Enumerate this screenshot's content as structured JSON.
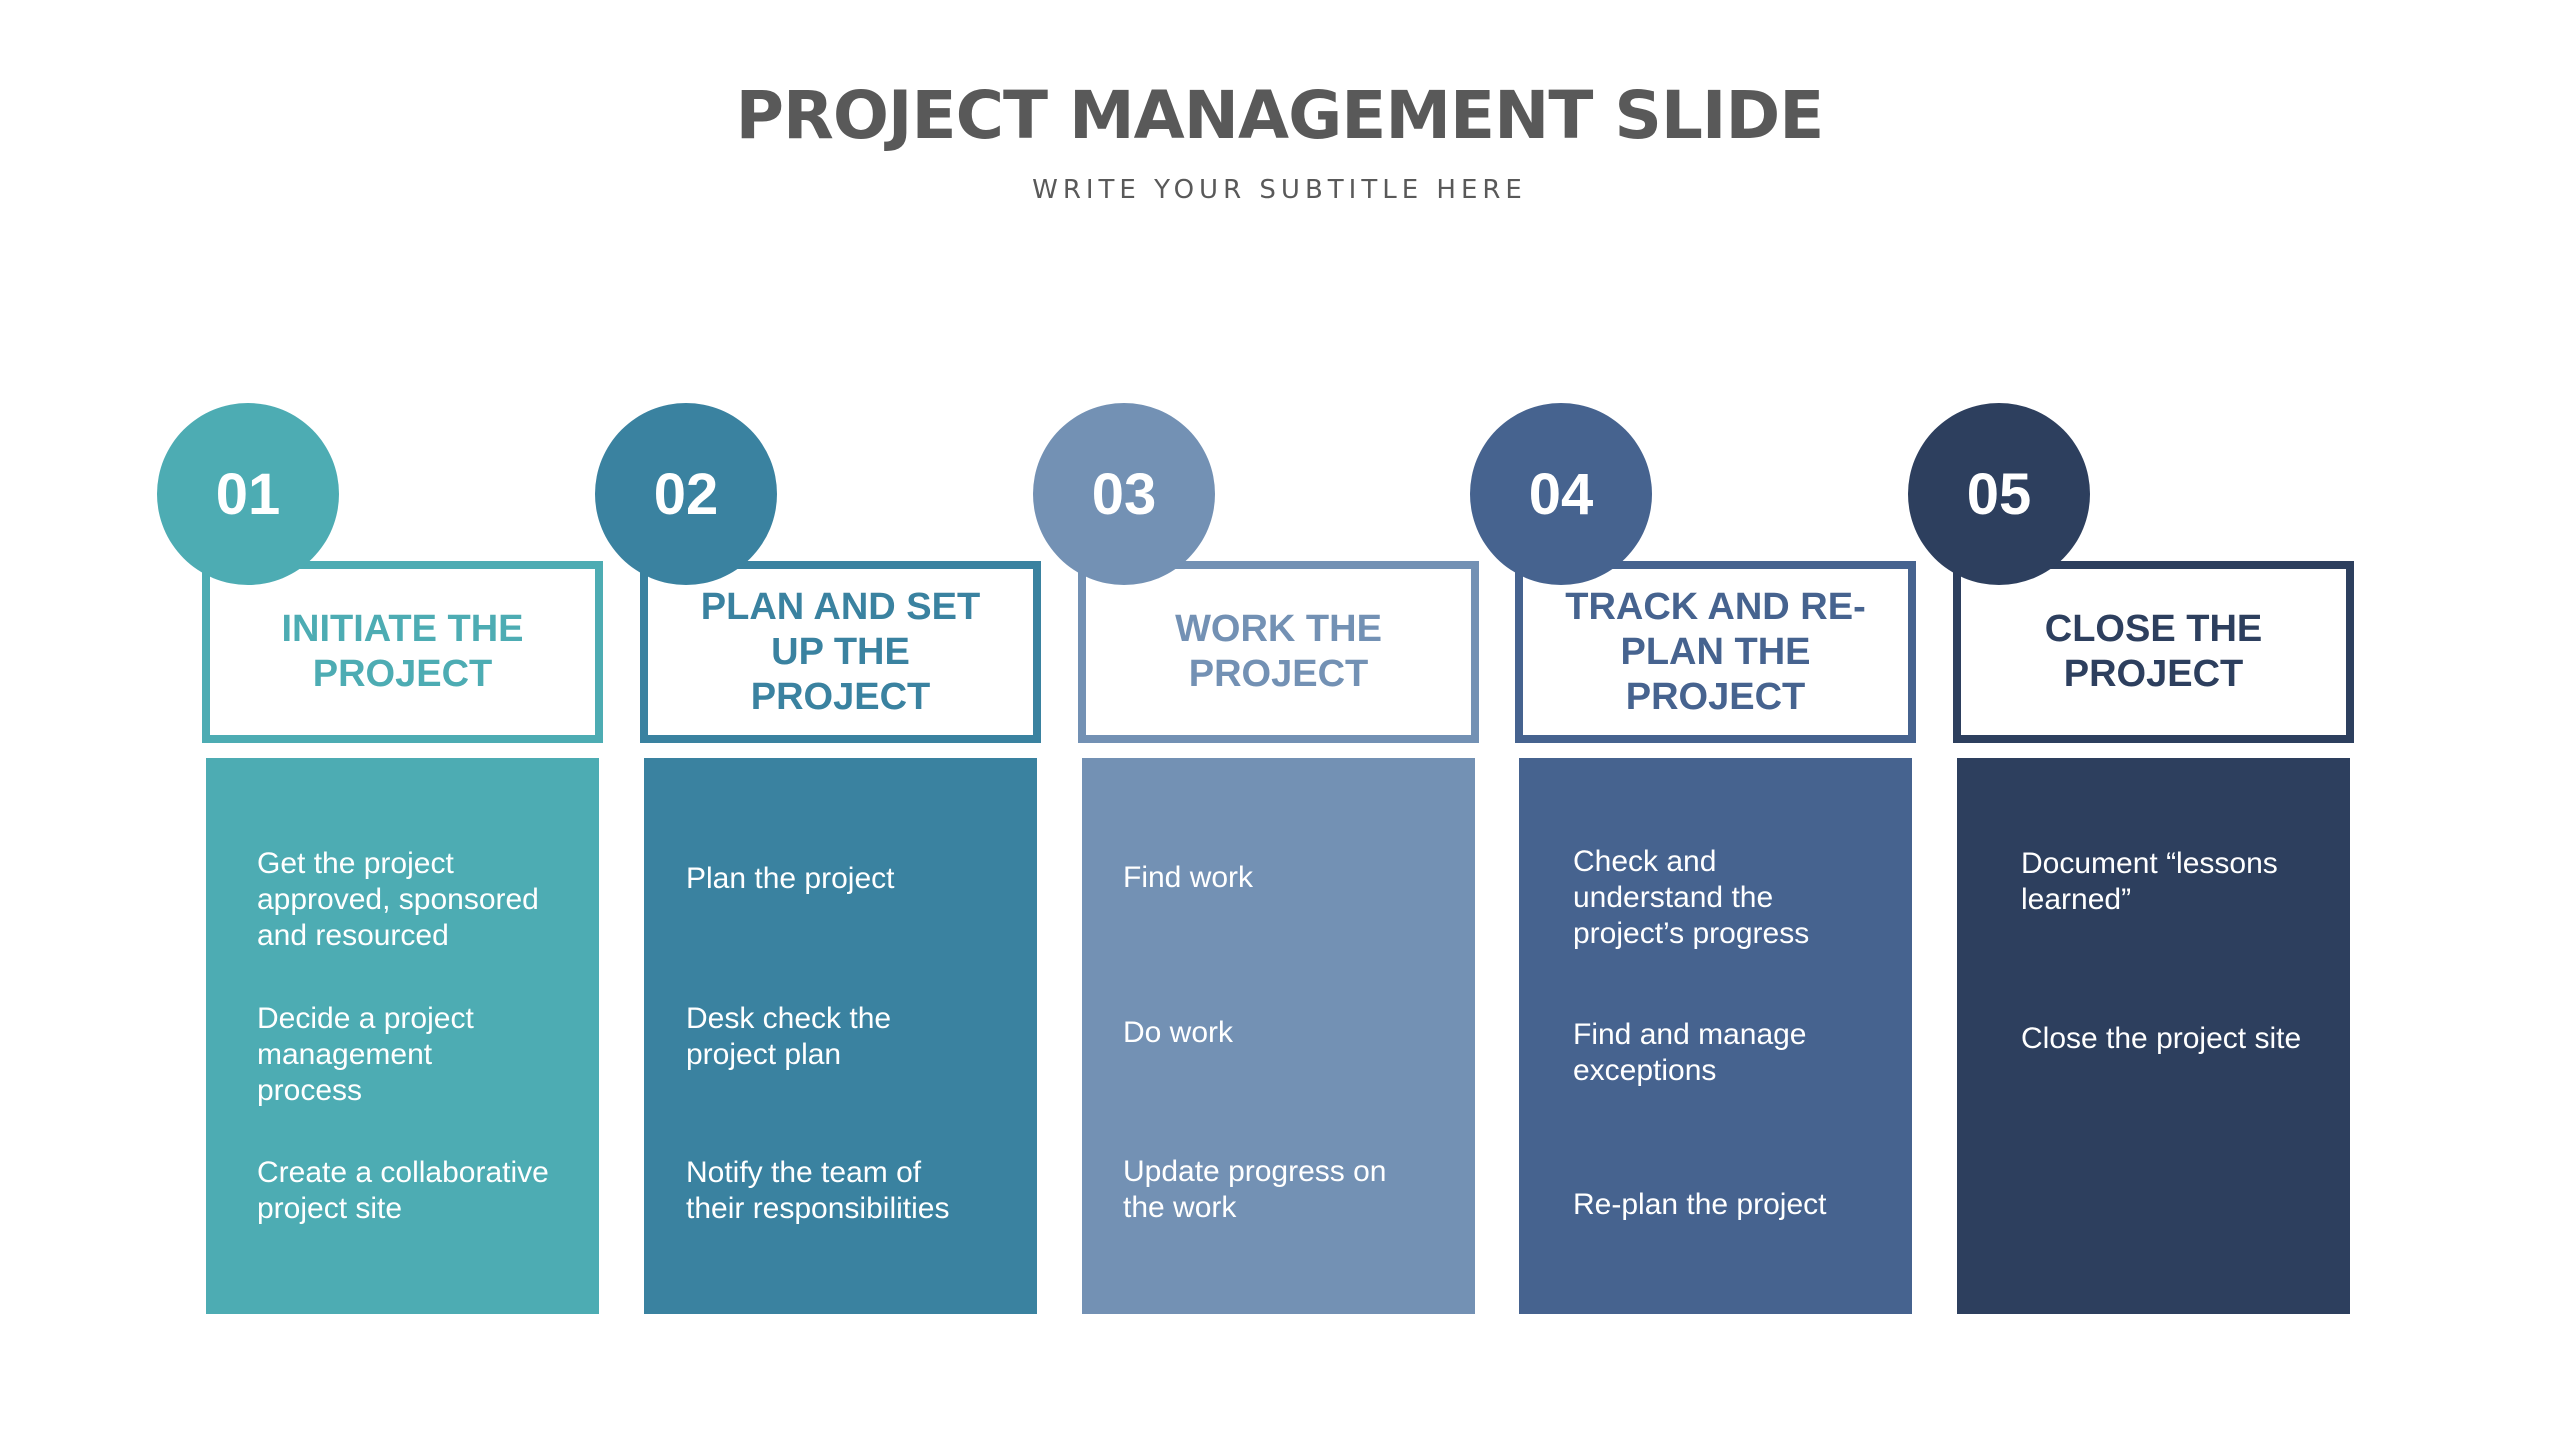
{
  "slide": {
    "title": "PROJECT MANAGEMENT SLIDE",
    "subtitle": "WRITE YOUR SUBTITLE HERE"
  },
  "theme": {
    "title_color": "#595959",
    "step_colors": [
      "#4DACB3",
      "#3A82A0",
      "#7391B4",
      "#46638F",
      "#2D3F5E"
    ]
  },
  "steps": [
    {
      "number": "01",
      "heading": "INITIATE THE PROJECT",
      "color": "#4DACB3",
      "items": [
        "Get the project approved, sponsored and resourced",
        "Decide a project management process",
        "Create a collaborative project site"
      ]
    },
    {
      "number": "02",
      "heading": "PLAN AND  SET UP THE PROJECT",
      "color": "#3A82A0",
      "items": [
        "Plan the project",
        "Desk check the project plan",
        "Notify the team of their responsibilities"
      ]
    },
    {
      "number": "03",
      "heading": "WORK THE PROJECT",
      "color": "#7391B4",
      "items": [
        "Find work",
        "Do work",
        "Update progress on the work"
      ]
    },
    {
      "number": "04",
      "heading": "TRACK AND RE-PLAN THE PROJECT",
      "color": "#46638F",
      "items": [
        "Check and understand the project’s progress",
        "Find and manage exceptions",
        "Re-plan the project"
      ]
    },
    {
      "number": "05",
      "heading": "CLOSE THE PROJECT",
      "color": "#2D3F5E",
      "items": [
        "Document “lessons learned”",
        "Close the project site"
      ]
    }
  ]
}
